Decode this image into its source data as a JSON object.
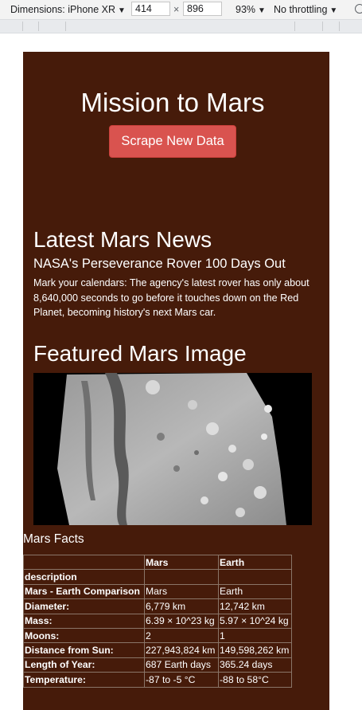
{
  "devtools": {
    "device_label": "Dimensions: iPhone XR",
    "width": "414",
    "height": "896",
    "zoom": "93%",
    "throttling": "No throttling"
  },
  "page": {
    "title": "Mission to Mars",
    "scrape_button": "Scrape New Data",
    "news_section_title": "Latest Mars News",
    "news_title": "NASA's Perseverance Rover 100 Days Out",
    "news_paragraph": "Mark your calendars: The agency's latest rover has only about 8,640,000 seconds to go before it touches down on the Red Planet, becoming history's next Mars car.",
    "featured_section_title": "Featured Mars Image",
    "facts_section_title": "Mars Facts",
    "facts_table": {
      "headers": [
        "",
        "Mars",
        "Earth"
      ],
      "index_label": "description",
      "rows": [
        [
          "Mars - Earth Comparison",
          "Mars",
          "Earth"
        ],
        [
          "Diameter:",
          "6,779 km",
          "12,742 km"
        ],
        [
          "Mass:",
          "6.39 × 10^23 kg",
          "5.97 × 10^24 kg"
        ],
        [
          "Moons:",
          "2",
          "1"
        ],
        [
          "Distance from Sun:",
          "227,943,824 km",
          "149,598,262 km"
        ],
        [
          "Length of Year:",
          "687 Earth days",
          "365.24 days"
        ],
        [
          "Temperature:",
          "-87 to -5 °C",
          "-88 to 58°C"
        ]
      ]
    }
  },
  "colors": {
    "page_background": "#461b0a",
    "button": "#d9534f"
  }
}
